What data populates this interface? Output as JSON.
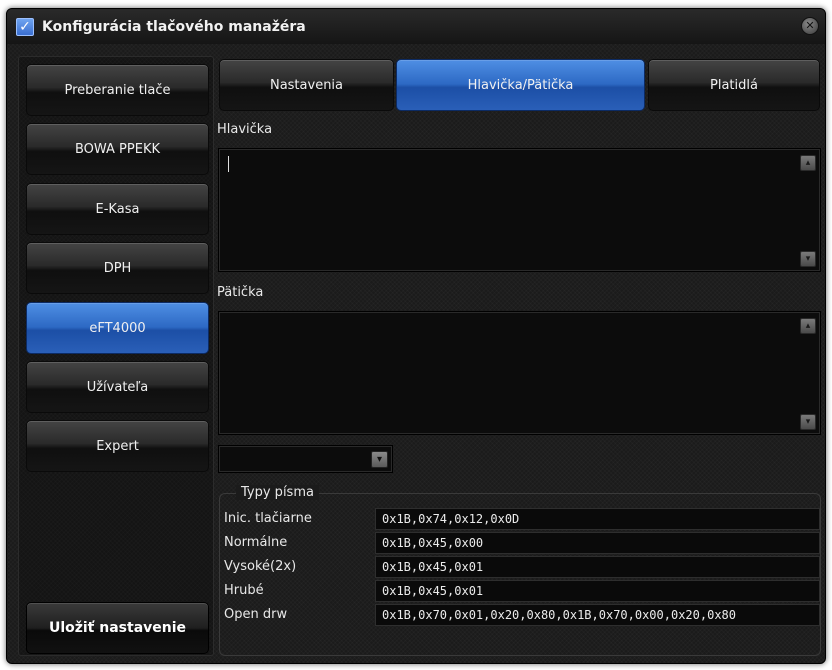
{
  "window": {
    "title": "Konfigurácia tlačového manažéra",
    "title_check": "✓",
    "close_glyph": "✕"
  },
  "sidebar": {
    "items": [
      {
        "label": "Preberanie tlače",
        "active": false
      },
      {
        "label": "BOWA PPEKK",
        "active": false
      },
      {
        "label": "E-Kasa",
        "active": false
      },
      {
        "label": "DPH",
        "active": false
      },
      {
        "label": "eFT4000",
        "active": true
      },
      {
        "label": "Užívateľa",
        "active": false
      },
      {
        "label": "Expert",
        "active": false
      }
    ],
    "save_label": "Uložiť nastavenie"
  },
  "tabs": [
    {
      "label": "Nastavenia",
      "active": false
    },
    {
      "label": "Hlavička/Pätička",
      "active": true
    },
    {
      "label": "Platidlá",
      "active": false
    }
  ],
  "header_section": {
    "label": "Hlavička",
    "value": ""
  },
  "footer_section": {
    "label": "Pätička",
    "value": ""
  },
  "dropdown": {
    "value": "",
    "arrow": "▾"
  },
  "font_types": {
    "legend": "Typy písma",
    "rows": [
      {
        "name": "Inic. tlačiarne",
        "value": "0x1B,0x74,0x12,0x0D"
      },
      {
        "name": "Normálne",
        "value": "0x1B,0x45,0x00"
      },
      {
        "name": "Vysoké(2x)",
        "value": "0x1B,0x45,0x01"
      },
      {
        "name": "Hrubé",
        "value": "0x1B,0x45,0x01"
      },
      {
        "name": "Open drw",
        "value": "0x1B,0x70,0x01,0x20,0x80,0x1B,0x70,0x00,0x20,0x80"
      }
    ]
  },
  "icons": {
    "scroll_up": "▴",
    "scroll_down": "▾"
  },
  "colors": {
    "accent": "#2d69c4",
    "background": "#1b1b1b"
  }
}
